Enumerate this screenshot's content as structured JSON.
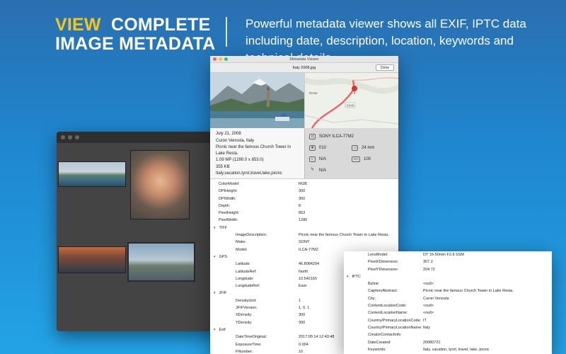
{
  "header": {
    "headline_accent": "VIEW",
    "headline_rest": "COMPLETE",
    "headline_line2": "IMAGE METADATA",
    "tagline": "Powerful metadata viewer shows all EXIF, IPTC data including date, description, location, keywords and technical details."
  },
  "viewer": {
    "window_title": "Metadata Viewer",
    "file_name": "Italy 2008.jpg",
    "done_label": "Done",
    "map_labels": {
      "town": "Resia",
      "route": "SS40"
    },
    "summary": {
      "date": "July 21, 2008",
      "location": "Curon Venosta, Italy",
      "description": "Picnic near the famous Church Tower in Lake Resia.",
      "resolution": "1.09 MP (1280.0 x 853.0)",
      "size": "355 KB",
      "keywords": "Italy,vacation,tyrol,travel,lake,picnic"
    },
    "camera": {
      "model": "SONY ILCA-77M2",
      "aperture": "f/10",
      "focal": "24 mm",
      "exposure": "N/A",
      "iso": "100",
      "flash": "N/A",
      "iso_label": "ISO"
    },
    "rows_top": [
      {
        "k": "ColorModel:",
        "v": "RGB"
      },
      {
        "k": "DPIHeight:",
        "v": "300"
      },
      {
        "k": "DPIWidth:",
        "v": "300"
      },
      {
        "k": "Depth:",
        "v": "8"
      },
      {
        "k": "PixelHeight:",
        "v": "853"
      },
      {
        "k": "PixelWidth:",
        "v": "1280"
      }
    ],
    "tiff_label": "TIFF",
    "tiff_rows": [
      {
        "k": "ImageDescription:",
        "v": "Picnic near the famous Church Tower in Lake Resia."
      },
      {
        "k": "Make:",
        "v": "SONY"
      },
      {
        "k": "Model:",
        "v": "ILCA-77M2"
      }
    ],
    "gps_label": "GPS",
    "gps_rows": [
      {
        "k": "Latitude:",
        "v": "46.8084204"
      },
      {
        "k": "LatitudeRef:",
        "v": "North"
      },
      {
        "k": "Longitude:",
        "v": "10.542165"
      },
      {
        "k": "LongitudeRef:",
        "v": "East"
      }
    ],
    "jfif_label": "JFIF",
    "jfif_rows": [
      {
        "k": "DensityUnit:",
        "v": "1"
      },
      {
        "k": "JFIFVersion:",
        "v": "1, 0, 1"
      },
      {
        "k": "XDensity:",
        "v": "300"
      },
      {
        "k": "YDensity:",
        "v": "300"
      }
    ],
    "exif_label": "Exif",
    "exif_rows": [
      {
        "k": "DateTimeOriginal:",
        "v": "2017:05:14 12:43:48"
      },
      {
        "k": "ExposureTime:",
        "v": "0.004"
      },
      {
        "k": "FNumber:",
        "v": "10"
      },
      {
        "k": "FocalLength:",
        "v": "24"
      },
      {
        "k": "ISOSpeedRatings:",
        "v": "100, 0"
      }
    ]
  },
  "panel2": {
    "rows_top": [
      {
        "k": "LensModel:",
        "v": "DT 16-50mm F2.8 SSM"
      },
      {
        "k": "PixelXDimension:",
        "v": "307.2"
      },
      {
        "k": "PixelYDimension:",
        "v": "204.72"
      }
    ],
    "iptc_label": "IPTC",
    "iptc_rows": [
      {
        "k": "Byline:",
        "v": "<null>"
      },
      {
        "k": "Caption/Abstract:",
        "v": "Picnic near the famous Church Tower in Lake Resia."
      },
      {
        "k": "City:",
        "v": "Curon Venosta"
      },
      {
        "k": "ContentLocationCode:",
        "v": "<null>"
      },
      {
        "k": "ContentLocationName:",
        "v": "<null>"
      },
      {
        "k": "Country/PrimaryLocationCode:",
        "v": "IT"
      },
      {
        "k": "Country/PrimaryLocationName:",
        "v": "Italy"
      },
      {
        "k": "CreatorContactInfo",
        "v": ""
      },
      {
        "k": "DateCreated:",
        "v": "20080721"
      },
      {
        "k": "Keywords:",
        "v": "Italy, vacation, tyrol, travel, lake, picnic"
      },
      {
        "k": "Province/State:",
        "v": "Trentino-Alto Adige/Sudtirol"
      }
    ]
  },
  "colors": {
    "accent": "#f4c51c",
    "background_top": "#2a6fb0",
    "background_bottom": "#23a3e6",
    "map_pin": "#d9342b",
    "route": "#e56b6b"
  }
}
